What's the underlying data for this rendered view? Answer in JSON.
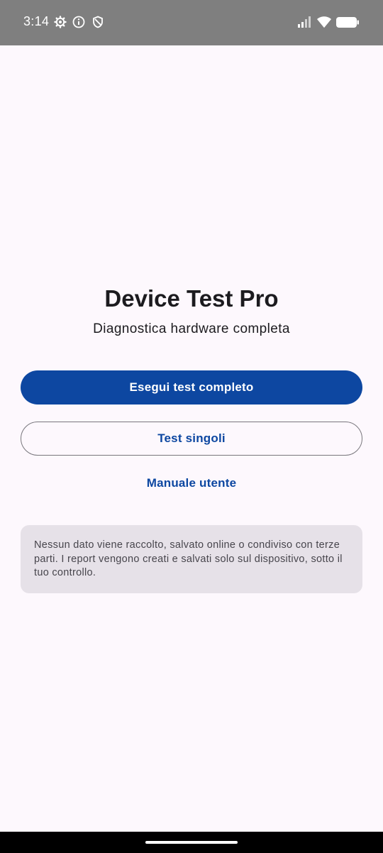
{
  "status_bar": {
    "time": "3:14",
    "left_icons": [
      "settings-icon",
      "info-icon",
      "shield-icon"
    ],
    "right_icons": [
      "signal-icon",
      "wifi-icon",
      "battery-icon"
    ]
  },
  "app": {
    "title": "Device Test Pro",
    "subtitle": "Diagnostica hardware completa"
  },
  "actions": {
    "full_test_label": "Esegui test completo",
    "single_tests_label": "Test singoli",
    "manual_label": "Manuale utente"
  },
  "privacy_note": {
    "text": "Nessun dato viene raccolto, salvato online o condiviso con terze parti. I report vengono creati e salvati solo sul dispositivo, sotto il tuo controllo."
  },
  "colors": {
    "primary": "#0d47a1",
    "background": "#fdf8fd",
    "card": "#e6e1e8",
    "status_bar": "#7f7f7f"
  }
}
